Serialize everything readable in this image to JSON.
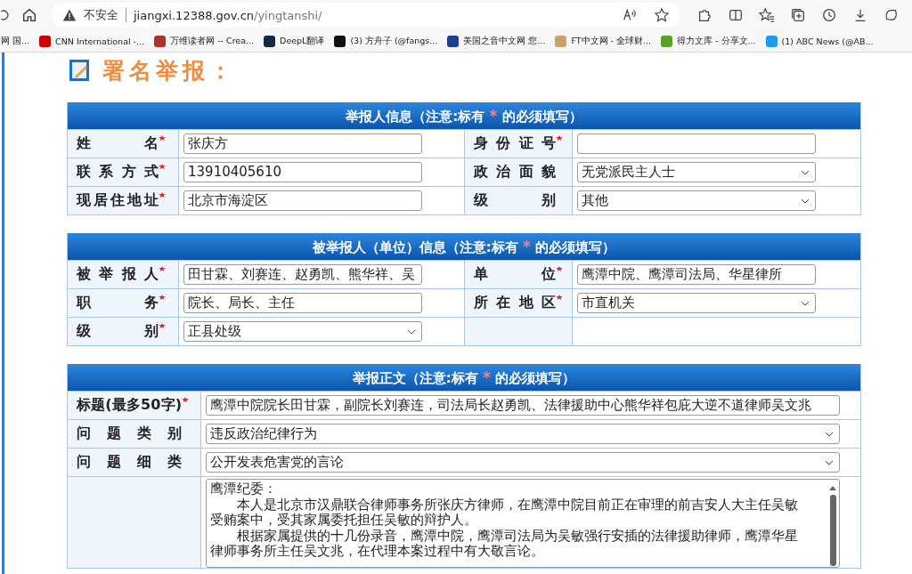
{
  "browser": {
    "address_bar": {
      "security": "不安全",
      "url_host": "jiangxi.12388.gov.cn",
      "url_path": "/yingtanshi/"
    },
    "bookmarks": [
      {
        "label": "网 国..."
      },
      {
        "label": "CNN International -...",
        "color": "#cc0000"
      },
      {
        "label": "万维读者网 -- Crea...",
        "color": "#b03030"
      },
      {
        "label": "DeepL翻译",
        "color": "#0f2b46"
      },
      {
        "label": "(3) 方舟子 (@fangs...",
        "color": "#111111"
      },
      {
        "label": "美国之音中文网 您...",
        "color": "#1d3f8f"
      },
      {
        "label": "FT中文网 - 全球财...",
        "color": "#c9a46a"
      },
      {
        "label": "得力文库 - 分享文...",
        "color": "#5aa02c"
      },
      {
        "label": "(1) ABC News (@AB...",
        "color": "#1d9bf0"
      }
    ]
  },
  "page": {
    "heading": "署名举报：",
    "sections": [
      {
        "title": "举报人信息（注意:标有",
        "marker": "*",
        "title_end": "的必须填写）",
        "rows": [
          [
            {
              "label": "姓名",
              "required": true,
              "kind": "text",
              "value": "张庆方"
            },
            {
              "label": "身份证号",
              "required": true,
              "kind": "text"
            }
          ],
          [
            {
              "label": "联系方式",
              "required": true,
              "kind": "text",
              "value": "13910405610"
            },
            {
              "label": "政治面貌",
              "required": false,
              "kind": "select",
              "value": "无党派民主人士"
            }
          ],
          [
            {
              "label": "现居住地址",
              "required": true,
              "kind": "text",
              "value": "北京市海淀区"
            },
            {
              "label": "级别",
              "required": false,
              "kind": "select",
              "value": "其他"
            }
          ]
        ]
      },
      {
        "title": "被举报人（单位）信息（注意:标有",
        "marker": "*",
        "title_end": "的必须填写）",
        "rows": [
          [
            {
              "label": "被举报人",
              "required": true,
              "kind": "text",
              "value": "田甘霖、刘赛连、赵勇凯、熊华祥、吴"
            },
            {
              "label": "单位",
              "required": true,
              "kind": "text",
              "value": "鹰潭中院、鹰潭司法局、华星律所"
            }
          ],
          [
            {
              "label": "职务",
              "required": true,
              "kind": "text",
              "value": "院长、局长、主任"
            },
            {
              "label": "所在地区",
              "required": true,
              "kind": "select",
              "value": "市直机关"
            }
          ],
          [
            {
              "label": "级别",
              "required": true,
              "kind": "select",
              "value": "正县处级"
            }
          ]
        ]
      },
      {
        "title": "举报正文（注意:标有",
        "marker": "*",
        "title_end": "的必须填写）",
        "rows": [
          [
            {
              "label": "标题(最多50字)",
              "required": true,
              "kind": "text",
              "value": "鹰潭中院院长田甘霖，副院长刘赛连，司法局长赵勇凯、法律援助中心熊华祥包庇大逆不道律师吴文兆"
            }
          ],
          [
            {
              "label": "问题类别",
              "required": false,
              "kind": "select",
              "value": "违反政治纪律行为"
            }
          ],
          [
            {
              "label": "问题细类",
              "required": false,
              "kind": "select",
              "value": "公开发表危害党的言论"
            }
          ],
          [
            {
              "kind": "textarea",
              "paragraphs": [
                {
                  "text": "鹰潭纪委：",
                  "indent": false
                },
                {
                  "text": "本人是北京市汉鼎联合律师事务所张庆方律师，在鹰潭中院目前正在审理的前吉安人大主任吴敏受贿案中，受其家属委托担任吴敏的辩护人。",
                  "indent": true
                },
                {
                  "text": "根据家属提供的十几份录音，鹰潭中院，鹰潭司法局为吴敏强行安插的法律援助律师，鹰潭华星律师事务所主任吴文兆，在代理本案过程中有大敬言论。",
                  "indent": true
                }
              ]
            }
          ]
        ]
      }
    ]
  }
}
